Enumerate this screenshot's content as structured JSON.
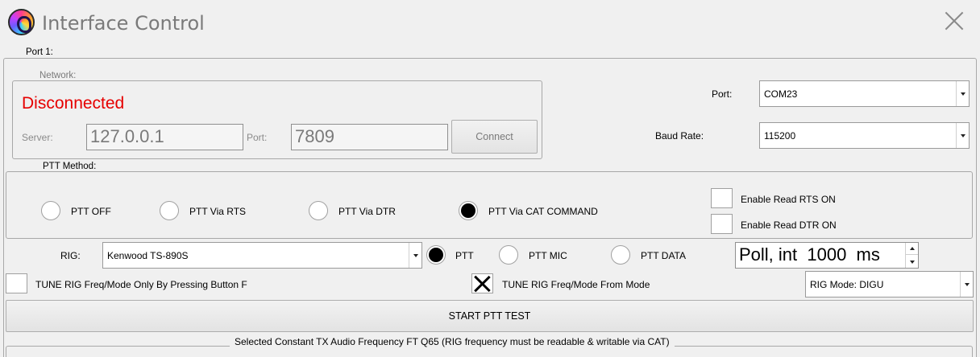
{
  "window": {
    "title": "Interface Control",
    "logo_icon": "app-logo-icon",
    "close_icon": "close-icon"
  },
  "port_group": {
    "legend": "Port 1:"
  },
  "network": {
    "legend": "Network:",
    "status": "Disconnected",
    "status_color": "#e60000",
    "server_label": "Server:",
    "server_value": "127.0.0.1",
    "port_label": "Port:",
    "port_value": "7809",
    "connect_label": "Connect"
  },
  "serial": {
    "port_label": "Port:",
    "port_value": "COM23",
    "baud_label": "Baud Rate:",
    "baud_value": "115200"
  },
  "ptt": {
    "legend": "PTT Method:",
    "options": [
      {
        "label": "PTT OFF",
        "selected": false
      },
      {
        "label": "PTT Via RTS",
        "selected": false
      },
      {
        "label": "PTT Via DTR",
        "selected": false
      },
      {
        "label": "PTT Via CAT COMMAND",
        "selected": true
      }
    ],
    "enable_rts_label": "Enable Read RTS ON",
    "enable_rts_checked": false,
    "enable_dtr_label": "Enable Read DTR ON",
    "enable_dtr_checked": false
  },
  "rig": {
    "label": "RIG:",
    "value": "Kenwood TS-890S",
    "ptt_modes": [
      {
        "label": "PTT",
        "selected": true
      },
      {
        "label": "PTT MIC",
        "selected": false
      },
      {
        "label": "PTT DATA",
        "selected": false
      }
    ],
    "poll_value": "Poll, int  1000  ms"
  },
  "tune": {
    "button_f_label": "TUNE RIG Freq/Mode Only By Pressing Button F",
    "button_f_checked": false,
    "from_mode_label": "TUNE RIG Freq/Mode From Mode",
    "from_mode_checked": true,
    "rig_mode_value": "RIG Mode: DIGU"
  },
  "test": {
    "start_label": "START PTT TEST",
    "footer_text": "Selected Constant TX  Audio Frequency FT Q65 (RIG frequency must be readable & writable via CAT)"
  }
}
